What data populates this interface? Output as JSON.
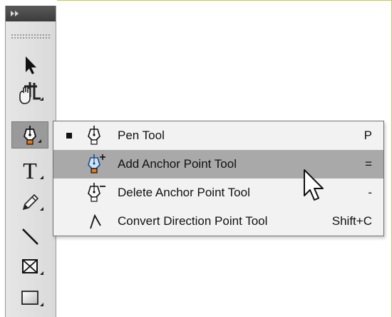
{
  "toolbar": {
    "collapse_icon": "double-chevron-right-icon",
    "tools": [
      {
        "name": "selection-tool",
        "icon": "arrow-cursor-icon"
      },
      {
        "name": "hand-crop-tool",
        "icon": "hand-crop-icon"
      },
      {
        "name": "pen-tool",
        "icon": "pen-icon",
        "active": true
      },
      {
        "name": "type-tool",
        "icon": "type-icon",
        "glyph": "T"
      },
      {
        "name": "pencil-tool",
        "icon": "pencil-icon"
      },
      {
        "name": "line-tool",
        "icon": "line-icon"
      },
      {
        "name": "rectangle-frame-tool",
        "icon": "rectangle-frame-icon"
      },
      {
        "name": "rectangle-tool",
        "icon": "rectangle-icon"
      }
    ]
  },
  "flyout": {
    "items": [
      {
        "label": "Pen Tool",
        "shortcut": "P",
        "icon": "pen-icon",
        "checked": true,
        "highlighted": false
      },
      {
        "label": "Add Anchor Point Tool",
        "shortcut": "=",
        "icon": "add-anchor-point-icon",
        "checked": false,
        "highlighted": true
      },
      {
        "label": "Delete Anchor Point Tool",
        "shortcut": "-",
        "icon": "delete-anchor-point-icon",
        "checked": false,
        "highlighted": false
      },
      {
        "label": "Convert Direction Point Tool",
        "shortcut": "Shift+C",
        "icon": "convert-direction-point-icon",
        "checked": false,
        "highlighted": false
      }
    ]
  },
  "colors": {
    "toolbar_header": "#3c3c3c",
    "menu_highlight": "#a9a9a9",
    "menu_background": "#f2f2f2",
    "frame_border": "#c6c85a",
    "pen_accent": "#e07a1a",
    "add_anchor_accent": "#2f7fd0"
  }
}
